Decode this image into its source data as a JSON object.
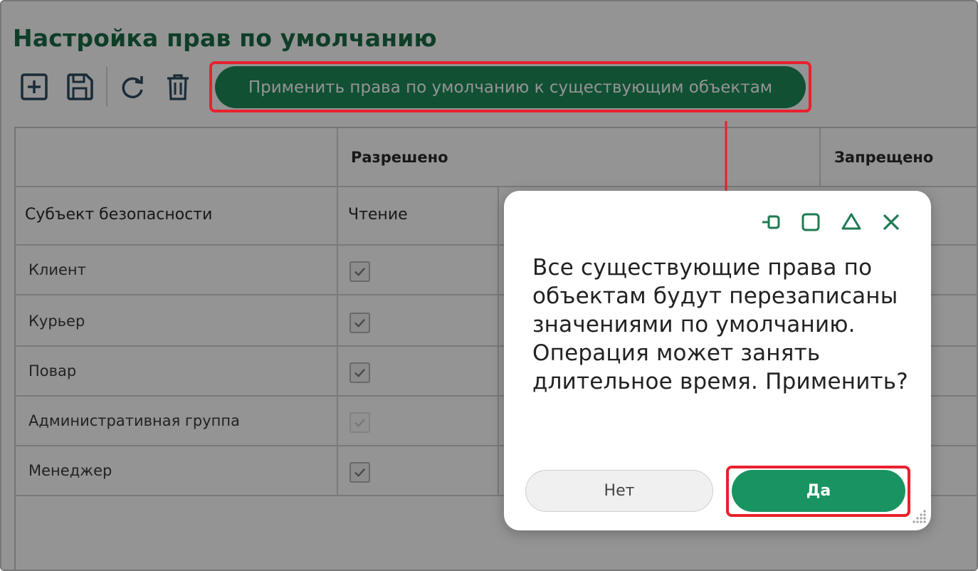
{
  "page": {
    "title": "Настройка прав по умолчанию"
  },
  "toolbar": {
    "icons": [
      "add-icon",
      "save-icon",
      "refresh-icon",
      "delete-icon"
    ],
    "apply_label": "Применить права по умолчанию к существующим объектам"
  },
  "table": {
    "group_headers": [
      "Разрешено",
      "Запрещено"
    ],
    "columns": [
      "Субъект безопасности",
      "Чтение"
    ],
    "rows": [
      {
        "subject": "Клиент",
        "read": true,
        "enabled": true
      },
      {
        "subject": "Курьер",
        "read": true,
        "enabled": true
      },
      {
        "subject": "Повар",
        "read": true,
        "enabled": true
      },
      {
        "subject": "Административная группа",
        "read": true,
        "enabled": false
      },
      {
        "subject": "Менеджер",
        "read": true,
        "enabled": true
      }
    ]
  },
  "dialog": {
    "controls": [
      "pin-icon",
      "maximize-icon",
      "collapse-icon",
      "close-icon"
    ],
    "message": "Все существующие права по объектам будут перезаписаны значениями по умолчанию. Операция может занять длительное время. Применить?",
    "no_label": "Нет",
    "yes_label": "Да"
  },
  "colors": {
    "accent": "#1e8a59",
    "title": "#1a6c45",
    "highlight": "#e8212e",
    "overlay": "rgba(0,0,0,0.42)"
  }
}
